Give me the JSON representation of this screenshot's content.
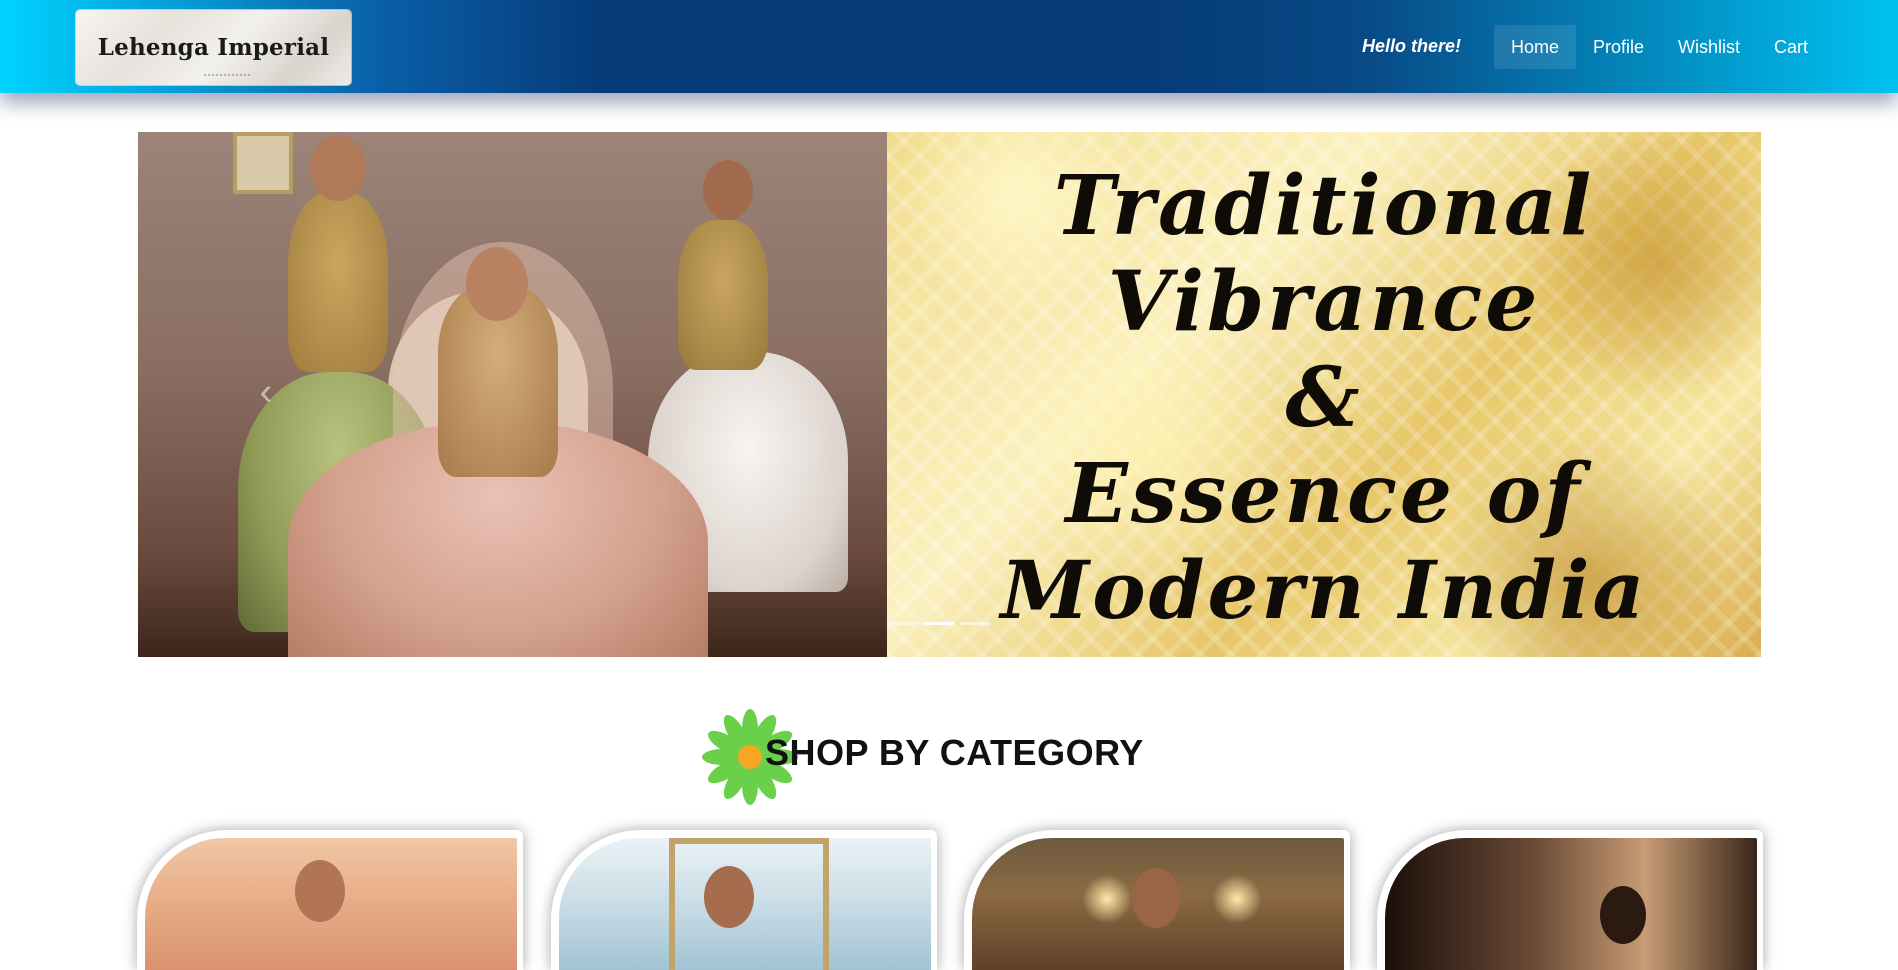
{
  "header": {
    "logo_text": "Lehenga Imperial",
    "greeting": "Hello there!",
    "nav": [
      {
        "label": "Home",
        "active": true
      },
      {
        "label": "Profile",
        "active": false
      },
      {
        "label": "Wishlist",
        "active": false
      },
      {
        "label": "Cart",
        "active": false
      }
    ]
  },
  "hero": {
    "banner_lines": [
      "Traditional",
      "Vibrance",
      "&",
      "Essence of",
      "Modern India"
    ],
    "prev_icon": "chevron-left-icon",
    "active_slide": 1,
    "slide_count": 3
  },
  "category_section": {
    "title": "SHOP BY CATEGORY",
    "icon": "flower-icon",
    "cards_visible": 4
  },
  "colors": {
    "nav_gradient_edge": "#00d4ff",
    "nav_gradient_center": "#063a78",
    "flower_petals": "#6ad04a",
    "flower_center": "#f5a623"
  }
}
